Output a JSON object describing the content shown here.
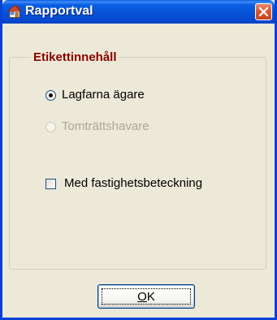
{
  "window": {
    "title": "Rapportval",
    "title_icon": "home-icon",
    "close_icon": "close-icon",
    "colors": {
      "titlebar": "#0650d4",
      "close_button": "#d85a36",
      "face": "#ece9d8",
      "group_title": "#8b0000"
    }
  },
  "group": {
    "title": "Etikettinnehåll",
    "options": [
      {
        "label": "Lagfarna ägare",
        "selected": true,
        "enabled": true
      },
      {
        "label": "Tomträttshavare",
        "selected": false,
        "enabled": false
      }
    ],
    "checkbox": {
      "label": "Med fastighetsbeteckning",
      "checked": false
    }
  },
  "buttons": {
    "ok_label": "OK"
  }
}
